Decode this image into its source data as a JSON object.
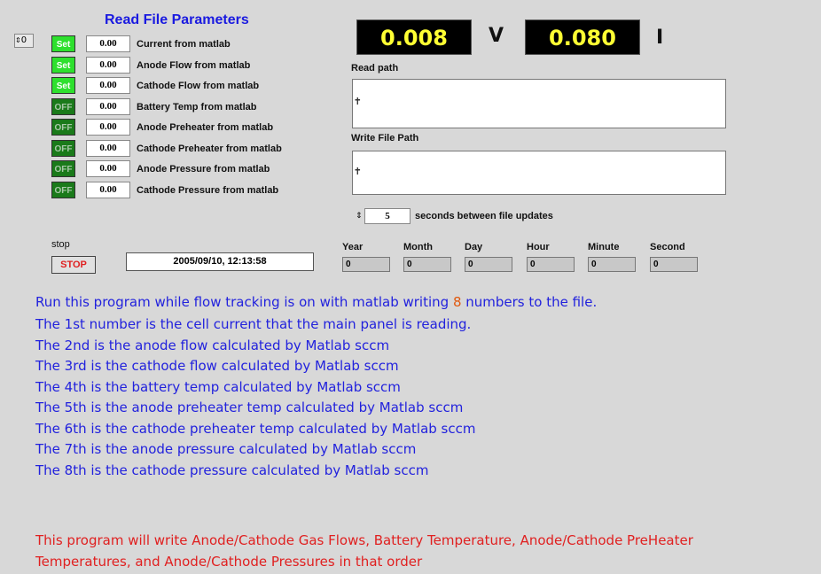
{
  "panel": {
    "title": "Read File Parameters",
    "index_spinner": "0",
    "params": [
      {
        "button": "Set",
        "state": "set",
        "value": "0.00",
        "label": "Current from matlab"
      },
      {
        "button": "Set",
        "state": "set",
        "value": "0.00",
        "label": "Anode Flow from matlab"
      },
      {
        "button": "Set",
        "state": "set",
        "value": "0.00",
        "label": "Cathode Flow from matlab"
      },
      {
        "button": "OFF",
        "state": "off",
        "value": "0.00",
        "label": "Battery Temp from matlab"
      },
      {
        "button": "OFF",
        "state": "off",
        "value": "0.00",
        "label": "Anode Preheater from matlab"
      },
      {
        "button": "OFF",
        "state": "off",
        "value": "0.00",
        "label": "Cathode Preheater from matlab"
      },
      {
        "button": "OFF",
        "state": "off",
        "value": "0.00",
        "label": "Anode Pressure from matlab"
      },
      {
        "button": "OFF",
        "state": "off",
        "value": "0.00",
        "label": "Cathode Pressure from matlab"
      }
    ]
  },
  "meters": {
    "voltage_value": "0.008",
    "voltage_unit": "V",
    "current_value": "0.080",
    "current_unit": "I"
  },
  "paths": {
    "read_label": "Read path",
    "read_value": "",
    "write_label": "Write File Path",
    "write_value": ""
  },
  "updates": {
    "seconds": "5",
    "label": "seconds between file updates"
  },
  "controls": {
    "stop_label": "stop",
    "stop_button": "STOP",
    "datetime": "2005/09/10,  12:13:58"
  },
  "time_fields": [
    {
      "label": "Year",
      "value": "0"
    },
    {
      "label": "Month",
      "value": "0"
    },
    {
      "label": "Day",
      "value": "0"
    },
    {
      "label": "Hour",
      "value": "0"
    },
    {
      "label": "Minute",
      "value": "0"
    },
    {
      "label": "Second",
      "value": "0"
    }
  ],
  "info": {
    "line1_pre": "Run this program while flow tracking is on with matlab writing ",
    "line1_num": "8",
    "line1_post": " numbers to the file.",
    "lines": [
      "The 1st number is the cell current that the main panel is reading.",
      "The 2nd is the anode flow calculated by Matlab sccm",
      "The 3rd is the cathode flow calculated by Matlab sccm",
      "The 4th is the battery temp calculated by Matlab sccm",
      "The 5th is the anode preheater temp calculated by Matlab sccm",
      "The 6th is the cathode preheater temp calculated by Matlab sccm",
      "The 7th is the anode pressure calculated by Matlab sccm",
      "The 8th is the cathode pressure calculated by Matlab sccm"
    ],
    "warning1": "This program will write Anode/Cathode Gas Flows, Battery Temperature, Anode/Cathode PreHeater",
    "warning2": "Temperatures, and Anode/Cathode Pressures in that order"
  },
  "colors": {
    "background": "#d8d8d8",
    "set_green": "#2ee02e",
    "off_green": "#1a7a1a",
    "meter_text": "#ffff33",
    "info_blue": "#2222dd",
    "warn_red": "#e02020"
  }
}
